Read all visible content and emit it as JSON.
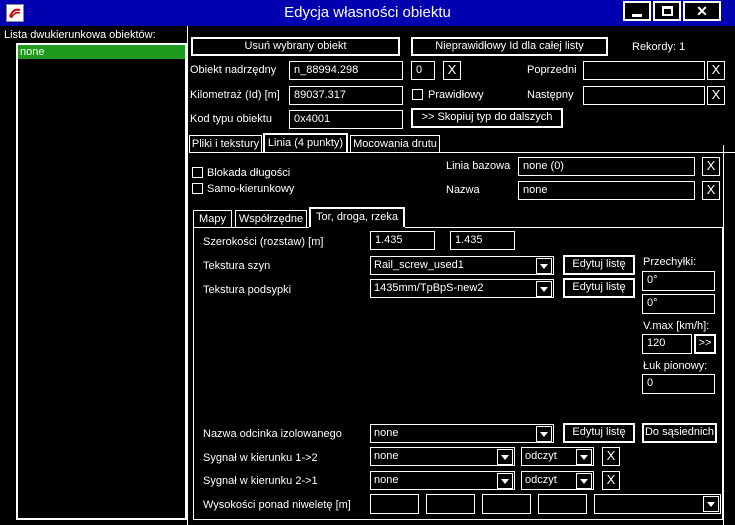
{
  "window": {
    "title": "Edycja własności obiektu"
  },
  "left_panel": {
    "label": "Lista dwukierunkowa obiektów:",
    "items": [
      "none"
    ]
  },
  "top": {
    "delete_button": "Usuń wybrany obiekt",
    "invalid_id_button": "Nieprawidłowy Id dla całej listy",
    "records": "Rekordy: 1",
    "parent_label": "Obiekt nadrzędny",
    "parent_value": "n_88994.298",
    "parent_index": "0",
    "prev_label": "Poprzedni",
    "km_label": "Kilometraż (Id) [m]",
    "km_value": "89037.317",
    "correct_label": "Prawidłowy",
    "next_label": "Następny",
    "type_label": "Kod typu obiektu",
    "type_value": "0x4001",
    "copy_type_button": ">> Skopiuj typ do dalszych"
  },
  "tabs": [
    "Pliki i tekstury",
    "Linia (4 punkty)",
    "Mocowania drutu"
  ],
  "linia": {
    "length_lock": "Blokada długości",
    "single_dir": "Samo-kierunkowy",
    "base_line_label": "Linia bazowa",
    "base_line_value": "none (0)",
    "name_label": "Nazwa",
    "name_value": "none"
  },
  "subtabs": [
    "Mapy",
    "Współrzędne",
    "Tor, droga, rzeka"
  ],
  "tor": {
    "width_label": "Szerokości (rozstaw) [m]",
    "width1": "1.435",
    "width2": "1.435",
    "rail_tex_label": "Tekstura szyn",
    "rail_tex_value": "Rail_screw_used1",
    "ballast_tex_label": "Tekstura podsypki",
    "ballast_tex_value": "1435mm/TpBpS-new2",
    "edit_list": "Edytuj listę",
    "tilt_label": "Przechyłki:",
    "tilt1": "0°",
    "tilt2": "0°",
    "vmax_label": "V.max [km/h]:",
    "vmax_value": "120",
    "vmax_btn": ">>",
    "vert_arc_label": "Łuk pionowy:",
    "vert_arc_value": "0",
    "insulated_label": "Nazwa odcinka izolowanego",
    "insulated_value": "none",
    "neighbors_btn": "Do sąsiednich",
    "sig12_label": "Sygnał w kierunku 1->2",
    "sig12_value": "none",
    "sig12_mode": "odczyt",
    "sig21_label": "Sygnał w kierunku 2->1",
    "sig21_value": "none",
    "sig21_mode": "odczyt",
    "heights_label": "Wysokości ponad niweletę [m]"
  },
  "icons": {
    "close": "X"
  },
  "colors": {
    "titlebar": "#0000b0",
    "selection": "#1e9a1e",
    "background": "#000000",
    "foreground": "#ffffff"
  }
}
